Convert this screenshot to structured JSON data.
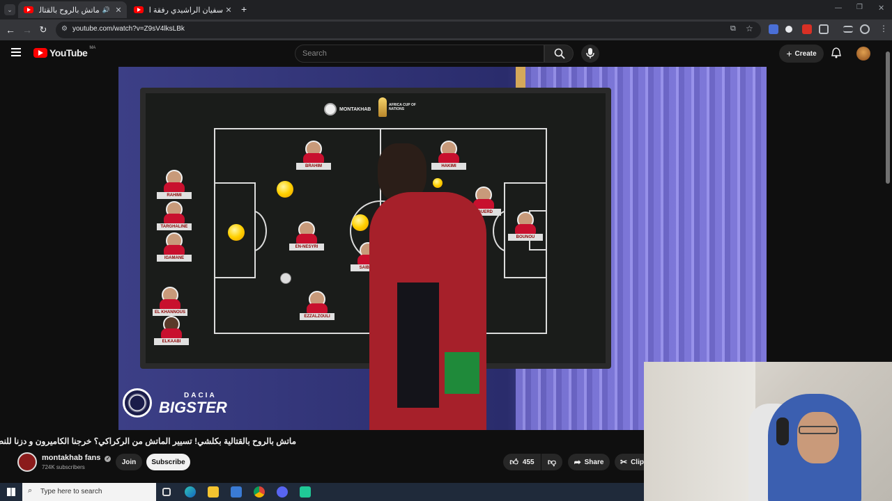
{
  "browser": {
    "tabs": [
      {
        "title": "ماتش بالروح بالقتالية بكلشي!",
        "active": true
      },
      {
        "title": "سفيان الراشيدي رفقة الباحث |",
        "active": false
      }
    ],
    "new_tab": "+",
    "url": "youtube.com/watch?v=Z9sV4lksLBk",
    "window_controls": [
      "minimize-icon",
      "restore-icon",
      "close-icon"
    ]
  },
  "youtube": {
    "logo_text": "YouTube",
    "region": "MA",
    "search_placeholder": "Search",
    "create_label": "Create"
  },
  "video": {
    "sponsor_top": "MONTAKHAB",
    "tournament": "AFRICA CUP OF NATIONS",
    "sponsor_bottom_small": "DACIA",
    "sponsor_bottom": "BIGSTER",
    "players": [
      {
        "name": "RAHIMI"
      },
      {
        "name": "TARGHALINE"
      },
      {
        "name": "IGAMANE"
      },
      {
        "name": "EL KHANNOUS"
      },
      {
        "name": "ELKAABI"
      },
      {
        "name": "BRAHIM"
      },
      {
        "name": "EN-NESYRI"
      },
      {
        "name": "SAIBARI"
      },
      {
        "name": "EZZALZOULI"
      },
      {
        "name": "HAKIMI"
      },
      {
        "name": "AGUERD"
      },
      {
        "name": "BOUNOU"
      }
    ]
  },
  "watch": {
    "title": "ماتش بالروح بالقتالية بكلشي! تسيير الماتش من الركراكي؟ خرجنا الكاميرون و دزنا للنصف",
    "channel_name": "montakhab fans",
    "subscribers": "724K subscribers",
    "join_label": "Join",
    "subscribe_label": "Subscribe",
    "likes": "455",
    "share_label": "Share",
    "clip_label": "Clip"
  },
  "taskbar": {
    "search_placeholder": "Type here to search"
  },
  "colors": {
    "yt_red": "#ff0000",
    "background": "#0f0f0f",
    "jersey_red": "#c8102e"
  }
}
